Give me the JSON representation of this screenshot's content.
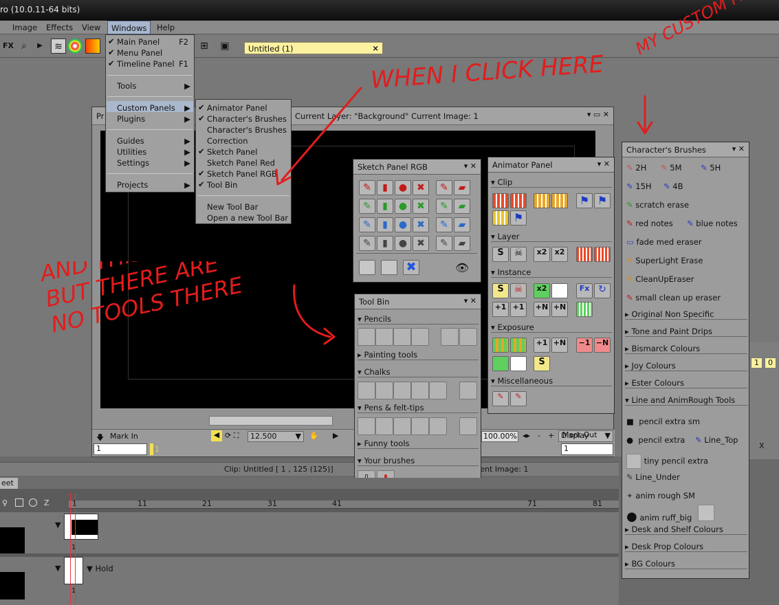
{
  "title_bar": {
    "text": "ro (10.0.11-64 bits)"
  },
  "menubar": {
    "items": [
      "Image",
      "Effects",
      "View",
      "Windows",
      "Help"
    ]
  },
  "toolbar": {
    "fx": "FX"
  },
  "tab": {
    "label": "Untitled (1)",
    "close": "×"
  },
  "windows_menu": {
    "items": [
      {
        "label": "Main Panel",
        "check": "✔",
        "key": "F2"
      },
      {
        "label": "Menu Panel",
        "check": "✔"
      },
      {
        "label": "Timeline Panel",
        "check": "✔",
        "key": "F1"
      },
      {
        "label": "Tools",
        "arrow": "▶"
      },
      {
        "label": "Custom Panels",
        "arrow": "▶"
      },
      {
        "label": "Plugins",
        "arrow": "▶"
      },
      {
        "label": "Guides",
        "arrow": "▶"
      },
      {
        "label": "Utilities",
        "arrow": "▶"
      },
      {
        "label": "Settings",
        "arrow": "▶"
      },
      {
        "label": "Projects",
        "arrow": "▶"
      }
    ]
  },
  "custom_panels_menu": {
    "items": [
      {
        "label": "Animator Panel",
        "check": "✔"
      },
      {
        "label": "Character's Brushes",
        "check": "✔"
      },
      {
        "label": "Character's Brushes",
        "check": ""
      },
      {
        "label": "Correction",
        "check": ""
      },
      {
        "label": "Sketch Panel",
        "check": "✔"
      },
      {
        "label": "Sketch Panel Red",
        "check": ""
      },
      {
        "label": "Sketch Panel RGB",
        "check": "✔"
      },
      {
        "label": "Tool Bin",
        "check": "✔"
      },
      {
        "label": "New Tool Bar",
        "check": ""
      },
      {
        "label": "Open a new Tool Bar",
        "check": ""
      }
    ]
  },
  "doc_window": {
    "title_prefix": "Pr",
    "info": "Current Layer: \"Background\"  Current Image: 1"
  },
  "doc_bottom": {
    "mark_in": "Mark In",
    "mark_out": "Mark Out",
    "in_value": "1",
    "out_value": "1",
    "frame_marker": "1",
    "fps": "12.500",
    "zoom": "100.00%",
    "display": "Display",
    "minus": "-",
    "plus": "+"
  },
  "status": {
    "clip": "Clip: Untitled [ 1 , 125  (125)]",
    "image": "rent Image: 1"
  },
  "sketch_panel": {
    "title": "Sketch Panel RGB"
  },
  "tool_bin": {
    "title": "Tool Bin",
    "sections": [
      "Pencils",
      "Painting tools",
      "Chalks",
      "Pens & felt-tips",
      "Funny tools",
      "Your brushes"
    ]
  },
  "animator_panel": {
    "title": "Animator Panel",
    "sections": [
      "Clip",
      "Layer",
      "Instance",
      "Exposure",
      "Miscellaneous"
    ],
    "exposure_buttons": [
      "+1",
      "+N",
      "−1",
      "−N"
    ],
    "s_label": "S"
  },
  "char_brushes": {
    "title": "Character's Brushes",
    "brushes": [
      {
        "label": "2H"
      },
      {
        "label": "5M"
      },
      {
        "label": "5H"
      },
      {
        "label": "15H"
      },
      {
        "label": "4B"
      },
      {
        "label": "scratch erase"
      },
      {
        "label": "red notes"
      },
      {
        "label": "blue notes"
      },
      {
        "label": "fade med eraser"
      },
      {
        "label": "SuperLight Erase"
      },
      {
        "label": "CleanUpEraser"
      },
      {
        "label": "small clean up eraser"
      }
    ],
    "groups": [
      "Original Non Specific",
      "Tone and Paint Drips",
      "Bismarck Colours",
      "Joy Colours",
      "Ester Colours",
      "Line and AnimRough Tools"
    ],
    "line_tools": [
      "pencil extra sm",
      "pencil extra",
      "Line_Top",
      "tiny pencil extra",
      "Line_Under",
      "anim rough SM",
      "anim ruff_big"
    ],
    "bottom_groups": [
      "Desk and Shelf Colours",
      "Desk Prop Colours",
      "BG Colours"
    ]
  },
  "timeline": {
    "tab": "eet",
    "z": "Z",
    "ticks": [
      "1",
      "11",
      "21",
      "31",
      "41",
      "71",
      "81"
    ],
    "hold": "Hold",
    "frame1": "1",
    "frame2": "1"
  },
  "right_edge": {
    "values": [
      "1",
      "0"
    ],
    "x": "X"
  },
  "annotations": {
    "a1": "WHEN I CLICK HERE",
    "a2": "MY CUSTOM PANEL",
    "a3": "AND THIS POPS UP BUT THERE ARE NO TOOLS THERE"
  }
}
